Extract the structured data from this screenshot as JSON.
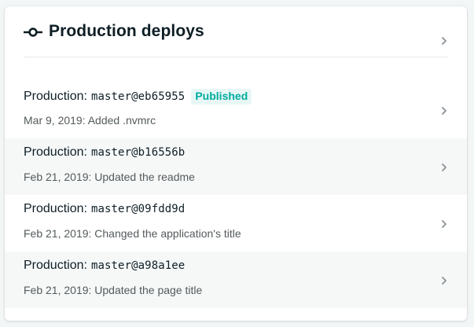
{
  "panel": {
    "title": "Production deploys",
    "title_icon": "git-commit-icon",
    "chevron_icon": "chevron-right-icon"
  },
  "deploys": [
    {
      "context": "Production:",
      "ref": "master@eb65955",
      "badge": "Published",
      "subtitle": "Mar 9, 2019: Added .nvmrc"
    },
    {
      "context": "Production:",
      "ref": "master@b16556b",
      "subtitle": "Feb 21, 2019: Updated the readme"
    },
    {
      "context": "Production:",
      "ref": "master@09fdd9d",
      "subtitle": "Feb 21, 2019: Changed the application's title"
    },
    {
      "context": "Production:",
      "ref": "master@a98a1ee",
      "subtitle": "Feb 21, 2019: Updated the page title"
    }
  ],
  "colors": {
    "text": "#0e1e25",
    "muted": "#545a5c",
    "badge_text": "#00ad9f",
    "badge_bg": "#e8f7f5",
    "row_alt": "#f6f8f8"
  }
}
